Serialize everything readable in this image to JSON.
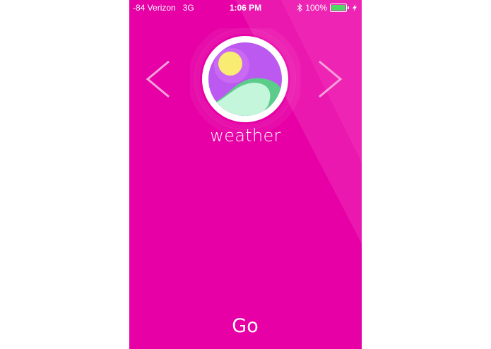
{
  "status_bar": {
    "carrier": "-84 Verizon",
    "network": "3G",
    "time": "1:06 PM",
    "battery": "100%",
    "battery_level": 1.0,
    "bluetooth_icon": "bluetooth-icon",
    "charging_icon": "charging-bolt-icon"
  },
  "carousel": {
    "prev_icon": "chevron-left-icon",
    "next_icon": "chevron-right-icon",
    "current_item": {
      "label": "weather",
      "icon": "weather-icon"
    }
  },
  "actions": {
    "go_label": "Go"
  },
  "colors": {
    "background": "#e600a6",
    "sheen": "#ef2bb6",
    "icon_purple": "#bb59f0",
    "sun_yellow": "#f8ec73",
    "hill_mint": "#c4f6dc",
    "hill_green": "#5ccc8a",
    "battery_green": "#4cd964",
    "text": "#ffffff"
  }
}
